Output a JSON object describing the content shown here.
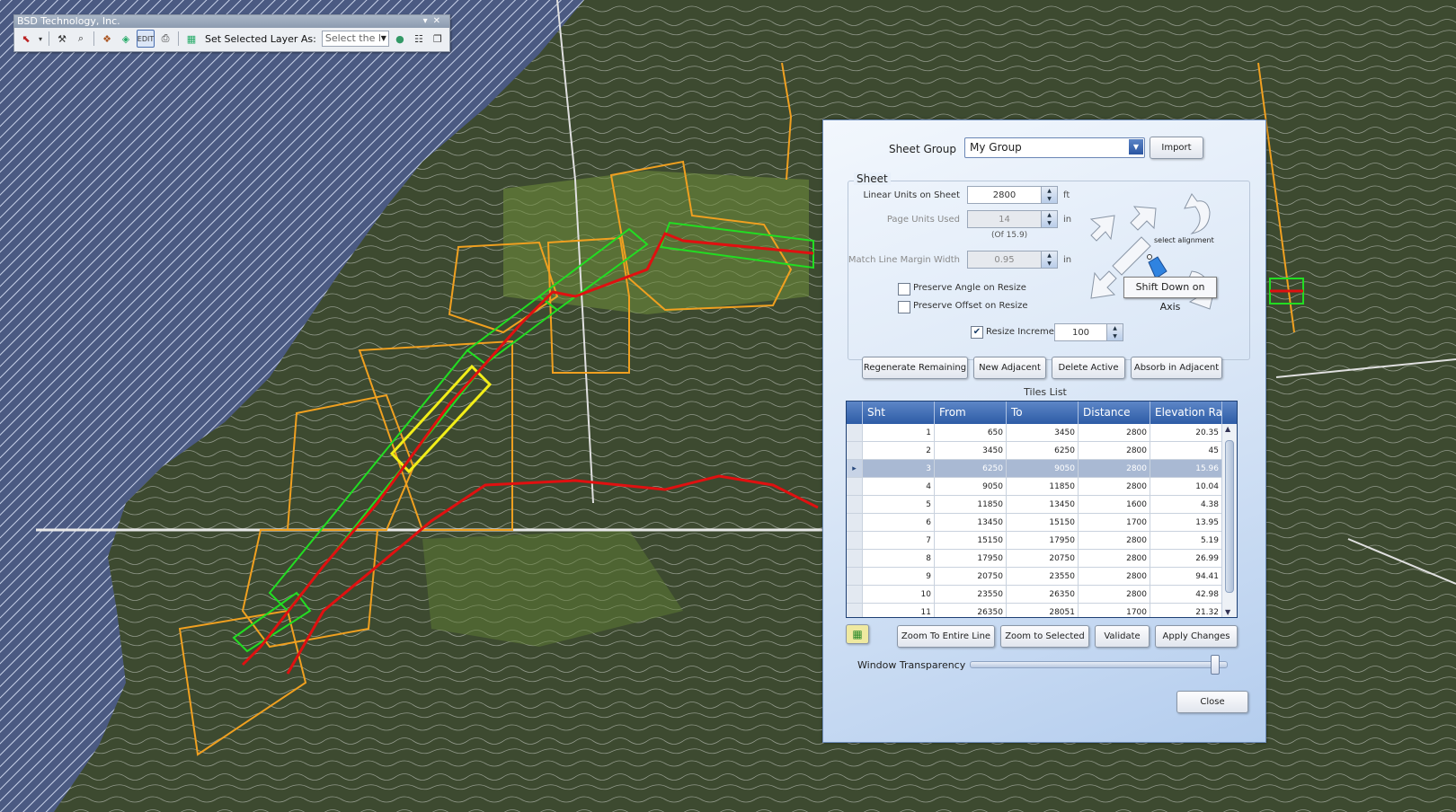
{
  "toolbar": {
    "title": "BSD Technology, Inc.",
    "set_layer_label": "Set Selected Layer As:",
    "layer_combo_value": "Select the l"
  },
  "dialog": {
    "sheet_group_label": "Sheet Group",
    "sheet_group_value": "My Group",
    "import_label": "Import",
    "sheet_legend": "Sheet",
    "linear_units_label": "Linear Units on Sheet",
    "linear_units_value": "2800",
    "linear_units_unit": "ft",
    "page_units_label": "Page Units Used",
    "page_units_value": "14",
    "page_units_unit": "in",
    "page_units_of": "(Of 15.9)",
    "match_line_label": "Match Line Margin Width",
    "match_line_value": "0.95",
    "match_line_unit": "in",
    "preserve_angle_label": "Preserve Angle on Resize",
    "preserve_offset_label": "Preserve Offset on Resize",
    "resize_increment_label": "Resize Increment",
    "resize_increment_value": "100",
    "select_alignment_label": "select alignment",
    "buttons": {
      "regenerate": "Regenerate Remaining",
      "new_adjacent": "New Adjacent",
      "delete_active": "Delete Active",
      "absorb": "Absorb in Adjacent"
    },
    "tiles_list_label": "Tiles List",
    "columns": [
      "Sht",
      "From",
      "To",
      "Distance",
      "Elevation Ra..."
    ],
    "rows": [
      [
        "1",
        "650",
        "3450",
        "2800",
        "20.35"
      ],
      [
        "2",
        "3450",
        "6250",
        "2800",
        "45"
      ],
      [
        "3",
        "6250",
        "9050",
        "2800",
        "15.96"
      ],
      [
        "4",
        "9050",
        "11850",
        "2800",
        "10.04"
      ],
      [
        "5",
        "11850",
        "13450",
        "1600",
        "4.38"
      ],
      [
        "6",
        "13450",
        "15150",
        "1700",
        "13.95"
      ],
      [
        "7",
        "15150",
        "17950",
        "2800",
        "5.19"
      ],
      [
        "8",
        "17950",
        "20750",
        "2800",
        "26.99"
      ],
      [
        "9",
        "20750",
        "23550",
        "2800",
        "94.41"
      ],
      [
        "10",
        "23550",
        "26350",
        "2800",
        "42.98"
      ],
      [
        "11",
        "26350",
        "28051",
        "1700",
        "21.32"
      ]
    ],
    "zoom_entire_label": "Zoom To Entire Line",
    "zoom_selected_label": "Zoom to Selected",
    "validate_label": "Validate",
    "apply_label": "Apply Changes",
    "transparency_label": "Window Transparency",
    "transparency_value": 0.97,
    "close_label": "Close"
  },
  "tooltip": "Shift Down on Axis",
  "colors": {
    "water_hatch": "#5b7fc4",
    "parcels": "#f0a020",
    "tiles": "#22dd22",
    "selected_tile": "#f2ee18",
    "alignment": "#e01010"
  }
}
